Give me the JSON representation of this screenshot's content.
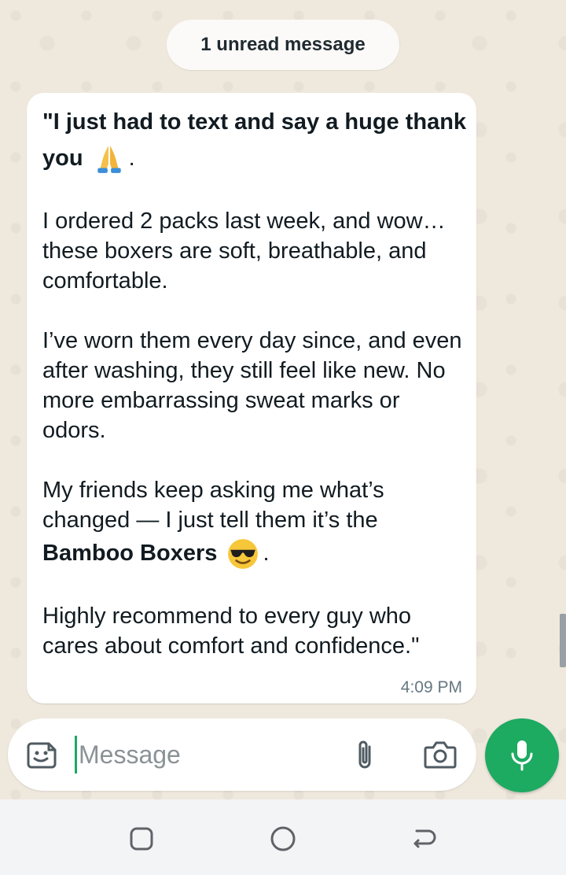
{
  "banner": {
    "unread_label": "1 unread message"
  },
  "message": {
    "intro_text": "\"I just had to text and say a huge thank you",
    "intro_emoji": "folded-hands-emoji",
    "intro_end": ".",
    "paragraph_1": "I ordered 2 packs last week, and wow… these boxers are soft, breathable, and comfortable.",
    "paragraph_2": "I’ve worn them every day since, and even after washing, they still feel like new. No more embarrassing sweat marks or odors.",
    "paragraph_3_start": "My friends keep asking me what’s changed — I just tell them it’s the",
    "product_name": "Bamboo Boxers",
    "product_emoji": "sunglasses-face-emoji",
    "paragraph_3_end": ".",
    "paragraph_4": "Highly recommend to every guy who cares about comfort and confidence.\"",
    "time": "4:09 PM"
  },
  "composer": {
    "placeholder": "Message",
    "icons": [
      "sticker-icon",
      "attach-icon",
      "camera-icon",
      "mic-icon"
    ]
  },
  "navigation": {
    "buttons": [
      "recents-button",
      "home-button",
      "back-button"
    ]
  },
  "colors": {
    "accent_green": "#1daa61",
    "bubble_bg": "#ffffff",
    "wallpaper_bg": "#efe8dd",
    "timestamp_gray": "#667781"
  }
}
